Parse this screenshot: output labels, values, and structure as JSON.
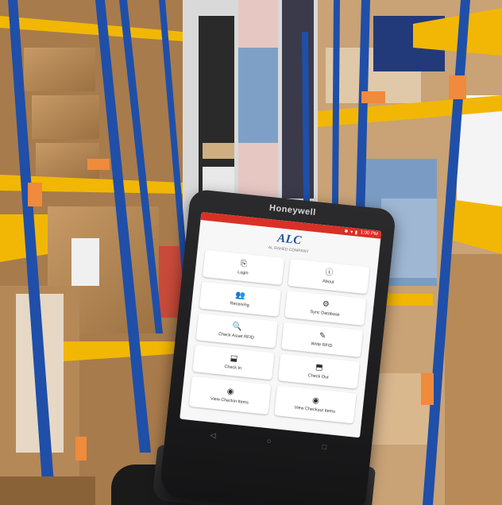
{
  "device": {
    "brand": "Honeywell",
    "status": {
      "icons": "✱ ▾ ▮",
      "time": "1:00 PM"
    },
    "app": {
      "logo": "ALC",
      "logo_sub": "AL RAHED COMPANY"
    },
    "menu": {
      "items": [
        {
          "label": "Login",
          "icon": "person-icon",
          "glyph": "⎘"
        },
        {
          "label": "About",
          "icon": "info-icon",
          "glyph": "ⓘ"
        },
        {
          "label": "Receiving",
          "icon": "receiving-icon",
          "glyph": "👥"
        },
        {
          "label": "Sync Database",
          "icon": "gear-icon",
          "glyph": "⚙"
        },
        {
          "label": "Check Asset RFID",
          "icon": "search-doc-icon",
          "glyph": "🔍"
        },
        {
          "label": "Write RFID",
          "icon": "edit-icon",
          "glyph": "✎"
        },
        {
          "label": "Check In",
          "icon": "box-in-icon",
          "glyph": "⬓"
        },
        {
          "label": "Check Out",
          "icon": "box-out-icon",
          "glyph": "⬒"
        },
        {
          "label": "View Checkin Items",
          "icon": "eye-icon",
          "glyph": "◉"
        },
        {
          "label": "View Checkout Items",
          "icon": "eye-icon",
          "glyph": "◉"
        }
      ]
    }
  },
  "colors": {
    "status_bar": "#d93025",
    "logo": "#1f4e9c",
    "shelf_frame": "#1f4fa8",
    "shelf_beam": "#f2b705",
    "cardboard": "#b98a5a"
  }
}
